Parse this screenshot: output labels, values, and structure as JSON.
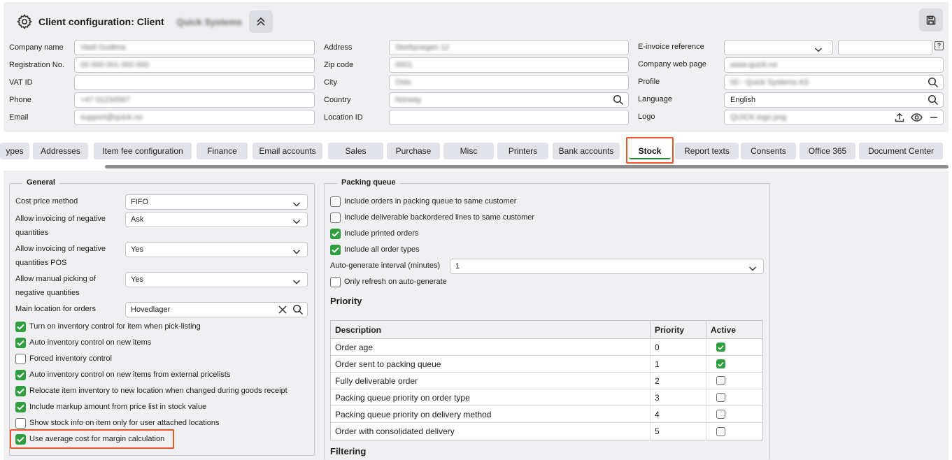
{
  "header": {
    "title": "Client configuration: Client",
    "client_name": "Quick Systems",
    "fields": {
      "company_name": {
        "label": "Company name",
        "value": "Vasil Gudima"
      },
      "registration_no": {
        "label": "Registration No.",
        "value": "00 000 001 000 000"
      },
      "vat_id": {
        "label": "VAT ID",
        "value": ""
      },
      "phone": {
        "label": "Phone",
        "value": "+47 01234567"
      },
      "email": {
        "label": "Email",
        "value": "support@quick.no"
      },
      "address": {
        "label": "Address",
        "value": "Storbyvegen 12"
      },
      "zip_code": {
        "label": "Zip code",
        "value": "0001"
      },
      "city": {
        "label": "City",
        "value": "Oslo"
      },
      "country": {
        "label": "Country",
        "value": "Norway"
      },
      "location_id": {
        "label": "Location ID",
        "value": ""
      },
      "einvoice_reference": {
        "label": "E-invoice reference",
        "value": "",
        "extra": ""
      },
      "company_web_page": {
        "label": "Company web page",
        "value": "www.quick.no"
      },
      "profile": {
        "label": "Profile",
        "value": "00 - Quick Systems AS"
      },
      "language": {
        "label": "Language",
        "value": "English"
      },
      "logo": {
        "label": "Logo",
        "value": "QUICK.logo.png"
      }
    },
    "help_glyph": "?"
  },
  "tabs": [
    {
      "label": "ypes"
    },
    {
      "label": "Addresses"
    },
    {
      "label": "Item fee configuration"
    },
    {
      "label": "Finance"
    },
    {
      "label": "Email accounts"
    },
    {
      "label": "Sales"
    },
    {
      "label": "Purchase"
    },
    {
      "label": "Misc"
    },
    {
      "label": "Printers"
    },
    {
      "label": "Bank accounts"
    },
    {
      "label": "Stock"
    },
    {
      "label": "Report texts"
    },
    {
      "label": "Consents"
    },
    {
      "label": "Office 365"
    },
    {
      "label": "Document Center"
    }
  ],
  "active_tab": "Stock",
  "general": {
    "legend": "General",
    "cost_price_method": {
      "label": "Cost price method",
      "value": "FIFO"
    },
    "allow_invoicing_negative": {
      "label_line1": "Allow invoicing of negative",
      "label_line2": "quantities",
      "value": "Ask"
    },
    "allow_invoicing_negative_pos": {
      "label_line1": "Allow invoicing of negative",
      "label_line2": "quantities POS",
      "value": "Yes"
    },
    "allow_manual_picking": {
      "label_line1": "Allow manual picking of",
      "label_line2": "negative quantities",
      "value": "Yes"
    },
    "main_location": {
      "label": "Main location for orders",
      "value": "Hovedlager"
    },
    "checkboxes": [
      {
        "label": "Turn on inventory control for item when pick-listing",
        "checked": true
      },
      {
        "label": "Auto inventory control on new items",
        "checked": true
      },
      {
        "label": "Forced inventory control",
        "checked": false
      },
      {
        "label": "Auto inventory control on new items from external pricelists",
        "checked": true
      },
      {
        "label": "Relocate item inventory to new location when changed during goods receipt",
        "checked": true
      },
      {
        "label": "Include markup amount from price list in stock value",
        "checked": true
      },
      {
        "label": "Show stock info on item only for user attached locations",
        "checked": false
      },
      {
        "label": "Use average cost for margin calculation",
        "checked": true
      }
    ]
  },
  "packing_queue": {
    "legend": "Packing queue",
    "checkboxes_top": [
      {
        "label": "Include orders in packing queue to same customer",
        "checked": false
      },
      {
        "label": "Include deliverable backordered lines to same customer",
        "checked": false
      },
      {
        "label": "Include printed orders",
        "checked": true
      },
      {
        "label": "Include all order types",
        "checked": true
      }
    ],
    "auto_interval": {
      "label": "Auto-generate interval (minutes)",
      "value": "1"
    },
    "only_refresh": {
      "label": "Only refresh on auto-generate",
      "checked": false
    },
    "priority_title": "Priority",
    "table": {
      "headers": {
        "description": "Description",
        "priority": "Priority",
        "active": "Active"
      },
      "rows": [
        {
          "description": "Order age",
          "priority": "0",
          "active": true
        },
        {
          "description": "Order sent to packing queue",
          "priority": "1",
          "active": true
        },
        {
          "description": "Fully deliverable order",
          "priority": "2",
          "active": false
        },
        {
          "description": "Packing queue priority on order type",
          "priority": "3",
          "active": false
        },
        {
          "description": "Packing queue priority on delivery method",
          "priority": "4",
          "active": false
        },
        {
          "description": "Order with consolidated delivery",
          "priority": "5",
          "active": false
        }
      ]
    },
    "filtering_title": "Filtering"
  },
  "colors": {
    "accent_green": "#2e9e3e",
    "highlight_orange": "#e8562a",
    "panel_bg": "#f0f0f3"
  }
}
